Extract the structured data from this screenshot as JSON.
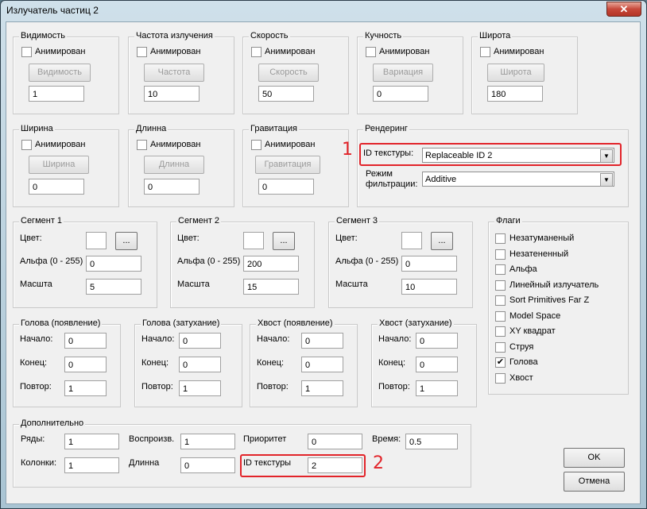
{
  "title": "Излучатель частиц 2",
  "close_glyph": "✕",
  "anim_label": "Анимирован",
  "top_groups": [
    {
      "title": "Видимость",
      "button": "Видимость",
      "value": "1"
    },
    {
      "title": "Частота излучения",
      "button": "Частота",
      "value": "10"
    },
    {
      "title": "Скорость",
      "button": "Скорость",
      "value": "50"
    },
    {
      "title": "Кучность",
      "button": "Вариация",
      "value": "0"
    },
    {
      "title": "Широта",
      "button": "Широта",
      "value": "180"
    }
  ],
  "mid_groups": [
    {
      "title": "Ширина",
      "button": "Ширина",
      "value": "0"
    },
    {
      "title": "Длинна",
      "button": "Длинна",
      "value": "0"
    },
    {
      "title": "Гравитация",
      "button": "Гравитация",
      "value": "0"
    }
  ],
  "rendering": {
    "title": "Рендеринг",
    "texture_label": "ID текстуры:",
    "texture_value": "Replaceable ID 2",
    "filter_label_1": "Режим",
    "filter_label_2": "фильтрации:",
    "filter_value": "Additive"
  },
  "segment_labels": {
    "color": "Цвет:",
    "alpha": "Альфа (0 - 255)",
    "scale": "Масшта",
    "more": "..."
  },
  "segments": [
    {
      "title": "Сегмент 1",
      "alpha": "0",
      "scale": "5"
    },
    {
      "title": "Сегмент 2",
      "alpha": "200",
      "scale": "15"
    },
    {
      "title": "Сегмент 3",
      "alpha": "0",
      "scale": "10"
    }
  ],
  "hv_labels": {
    "start": "Начало:",
    "end": "Конец:",
    "repeat": "Повтор:"
  },
  "hv_groups": [
    {
      "title": "Голова (появление)",
      "start": "0",
      "end": "0",
      "repeat": "1"
    },
    {
      "title": "Голова (затухание)",
      "start": "0",
      "end": "0",
      "repeat": "1"
    },
    {
      "title": "Хвост (появление)",
      "start": "0",
      "end": "0",
      "repeat": "1"
    },
    {
      "title": "Хвост (затухание)",
      "start": "0",
      "end": "0",
      "repeat": "1"
    }
  ],
  "flags": {
    "title": "Флаги",
    "items": [
      {
        "label": "Незатуманеный",
        "mark": ""
      },
      {
        "label": "Незатененный",
        "mark": ""
      },
      {
        "label": "Альфа",
        "mark": ""
      },
      {
        "label": "Линейный излучатель",
        "mark": ""
      },
      {
        "label": "Sort Primitives Far Z",
        "mark": ""
      },
      {
        "label": "Model Space",
        "mark": ""
      },
      {
        "label": "XY квадрат",
        "mark": ""
      },
      {
        "label": "Струя",
        "mark": ""
      },
      {
        "label": "Голова",
        "mark": "✔"
      },
      {
        "label": "Хвост",
        "mark": ""
      }
    ]
  },
  "extra": {
    "title": "Дополнительно",
    "rows_label": "Ряды:",
    "rows": "1",
    "playback_label": "Воспроизв.",
    "playback": "1",
    "priority_label": "Приоритет",
    "priority": "0",
    "time_label": "Время:",
    "time": "0.5",
    "cols_label": "Колонки:",
    "cols": "1",
    "length_label": "Длинна",
    "length": "0",
    "texid_label": "ID текстуры",
    "texid": "2"
  },
  "ok": "OK",
  "cancel": "Отмена",
  "annotations": {
    "one": "1",
    "two": "2"
  },
  "dropdown_arrow": "▼"
}
